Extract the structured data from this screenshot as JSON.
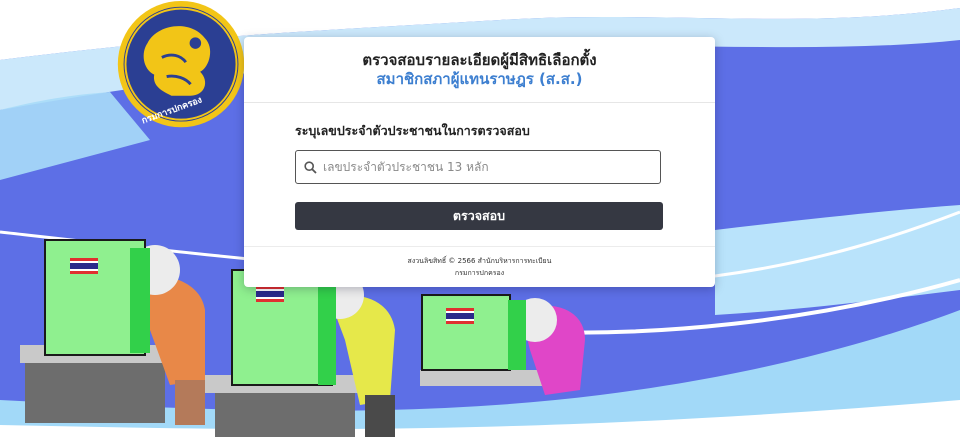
{
  "header": {
    "title": "ตรวจสอบรายละเอียดผู้มีสิทธิเลือกตั้ง",
    "subtitle": "สมาชิกสภาผู้แทนราษฎร (ส.ส.)"
  },
  "form": {
    "label": "ระบุเลขประจำตัวประชาชนในการตรวจสอบ",
    "input_value": "",
    "input_placeholder": "เลขประจำตัวประชาชน 13 หลัก",
    "submit_label": "ตรวจสอบ"
  },
  "footer": {
    "copyright": "สงวนลิขสิทธิ์ © 2566 สำนักบริหารการทะเบียน",
    "org": "กรมการปกครอง"
  },
  "logo": {
    "text": "กรมการปกครอง"
  },
  "colors": {
    "background_blue": "#5d6fe6",
    "light_blue": "#9ad4f7",
    "accent_blue": "#3d7fd0",
    "button": "#353842",
    "booth_green": "#8ff08f"
  }
}
